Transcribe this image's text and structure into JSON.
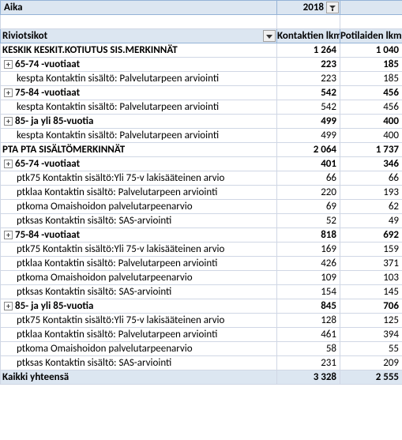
{
  "filter": {
    "label": "Aika",
    "value": "2018"
  },
  "columns": {
    "c0": "Riviotsikot",
    "c1": "Kontaktien lkm",
    "c2": "Potilaiden lkm"
  },
  "glyphs": {
    "plus": "+",
    "minus": "−"
  },
  "rows": [
    {
      "type": "section",
      "label": "KESKIK KESKIT.KOTIUTUS SIS.MERKINNÄT",
      "v1": "1 264",
      "v2": "1 040"
    },
    {
      "type": "group",
      "exp": "plus",
      "label": "65-74 -vuotiaat",
      "v1": "223",
      "v2": "185"
    },
    {
      "type": "detail",
      "label": "kespta Kontaktin sisältö: Palvelutarpeen arviointi",
      "v1": "223",
      "v2": "185"
    },
    {
      "type": "group",
      "exp": "plus",
      "label": "75-84 -vuotiaat",
      "v1": "542",
      "v2": "456"
    },
    {
      "type": "detail",
      "label": "kespta Kontaktin sisältö: Palvelutarpeen arviointi",
      "v1": "542",
      "v2": "456"
    },
    {
      "type": "group",
      "exp": "plus",
      "label": "85- ja yli 85-vuotia",
      "v1": "499",
      "v2": "400"
    },
    {
      "type": "detail",
      "label": "kespta Kontaktin sisältö: Palvelutarpeen arviointi",
      "v1": "499",
      "v2": "400"
    },
    {
      "type": "section",
      "label": "PTA PTA SISÄLTÖMERKINNÄT",
      "v1": "2 064",
      "v2": "1 737"
    },
    {
      "type": "group",
      "exp": "plus",
      "label": "65-74 -vuotiaat",
      "v1": "401",
      "v2": "346"
    },
    {
      "type": "detail",
      "label": "ptk75 Kontaktin sisältö:Yli 75-v lakisääteinen arvio",
      "v1": "66",
      "v2": "66"
    },
    {
      "type": "detail",
      "label": "ptklaa Kontaktin sisältö: Palvelutarpeen arviointi",
      "v1": "220",
      "v2": "193"
    },
    {
      "type": "detail",
      "label": "ptkoma Omaishoidon palvelutarpeenarvio",
      "v1": "69",
      "v2": "62"
    },
    {
      "type": "detail",
      "label": "ptksas Kontaktin sisältö: SAS-arviointi",
      "v1": "52",
      "v2": "49"
    },
    {
      "type": "group",
      "exp": "plus",
      "label": "75-84 -vuotiaat",
      "v1": "818",
      "v2": "692"
    },
    {
      "type": "detail",
      "label": "ptk75 Kontaktin sisältö:Yli 75-v lakisääteinen arvio",
      "v1": "169",
      "v2": "159"
    },
    {
      "type": "detail",
      "label": "ptklaa Kontaktin sisältö: Palvelutarpeen arviointi",
      "v1": "426",
      "v2": "371"
    },
    {
      "type": "detail",
      "label": "ptkoma Omaishoidon palvelutarpeenarvio",
      "v1": "109",
      "v2": "103"
    },
    {
      "type": "detail",
      "label": "ptksas Kontaktin sisältö: SAS-arviointi",
      "v1": "154",
      "v2": "145"
    },
    {
      "type": "group",
      "exp": "plus",
      "label": "85- ja yli 85-vuotia",
      "v1": "845",
      "v2": "706"
    },
    {
      "type": "detail",
      "label": "ptk75 Kontaktin sisältö:Yli 75-v lakisääteinen arvio",
      "v1": "128",
      "v2": "125"
    },
    {
      "type": "detail",
      "label": "ptklaa Kontaktin sisältö: Palvelutarpeen arviointi",
      "v1": "461",
      "v2": "394"
    },
    {
      "type": "detail",
      "label": "ptkoma Omaishoidon palvelutarpeenarvio",
      "v1": "58",
      "v2": "55"
    },
    {
      "type": "detail",
      "label": "ptksas Kontaktin sisältö: SAS-arviointi",
      "v1": "231",
      "v2": "209"
    }
  ],
  "total": {
    "label": "Kaikki yhteensä",
    "v1": "3 328",
    "v2": "2 555"
  }
}
